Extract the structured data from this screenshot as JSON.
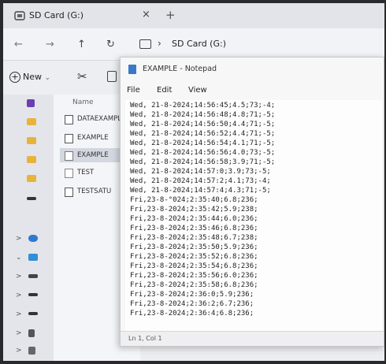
{
  "explorer": {
    "tab_title": "SD Card (G:)",
    "tab_close": "×",
    "new_tab": "+",
    "nav": {
      "back": "←",
      "forward": "→",
      "up": "↑",
      "refresh": "↻"
    },
    "breadcrumb_sep": "›",
    "breadcrumb": "SD Card (G:)",
    "new_label": "New",
    "new_caret": "⌄",
    "cut_glyph": "✂",
    "column_name": "Name",
    "files": [
      {
        "name": "DATAEXAMPLE"
      },
      {
        "name": "EXAMPLE"
      },
      {
        "name": "EXAMPLE"
      },
      {
        "name": "TEST"
      },
      {
        "name": "TESTSATU"
      }
    ],
    "sidebar_chevrons": [
      ">",
      "⌄",
      ">",
      ">",
      ">",
      ">",
      ">"
    ]
  },
  "notepad": {
    "title": "EXAMPLE - Notepad",
    "menu": [
      "File",
      "Edit",
      "View"
    ],
    "lines": [
      "Wed, 21-8-2024;14:56:45;4.5;73;-4;",
      "Wed, 21-8-2024;14:56:48;4.8;71;-5;",
      "Wed, 21-8-2024;14:56:50;4.4;71;-5;",
      "Wed, 21-8-2024;14:56:52;4.4;71;-5;",
      "Wed, 21-8-2024;14:56:54;4.1;71;-5;",
      "Wed, 21-8-2024;14:56:56;4.0;73;-5;",
      "Wed, 21-8-2024;14:56:58;3.9;71;-5;",
      "Wed, 21-8-2024;14:57:0;3.9;73;-5;",
      "Wed, 21-8-2024;14:57:2;4.1;73;-4;",
      "Wed, 21-8-2024;14:57:4;4.3;71;-5;",
      "Fri,23-8-°024;2:35:40;6.8;236;",
      "Fri,23-8-2024;2:35:42;5.9;238;",
      "Fri,23-8-2024;2:35:44;6.0;236;",
      "Fri,23-8-2024;2:35:46;6.8;236;",
      "Fri,23-8-2024;2:35:48;6.7;238;",
      "Fri,23-8-2024;2:35:50;5.9;236;",
      "Fri,23-8-2024;2:35:52;6.8;236;",
      "Fri,23-8-2024;2:35:54;6.8;236;",
      "Fri,23-8-2024;2:35:56;6.0;236;",
      "Fri,23-8-2024;2:35:58;6.8;236;",
      "Fri,23-8-2024;2:36:0;5.9;236;",
      "Fri,23-8-2024;2:36:2;6.7;236;",
      "Fri,23-8-2024;2:36:4;6.8;236;"
    ],
    "status": "Ln 1, Col 1"
  },
  "colors": {
    "folder": "#e8b33a",
    "accent": "#3a78c8"
  }
}
